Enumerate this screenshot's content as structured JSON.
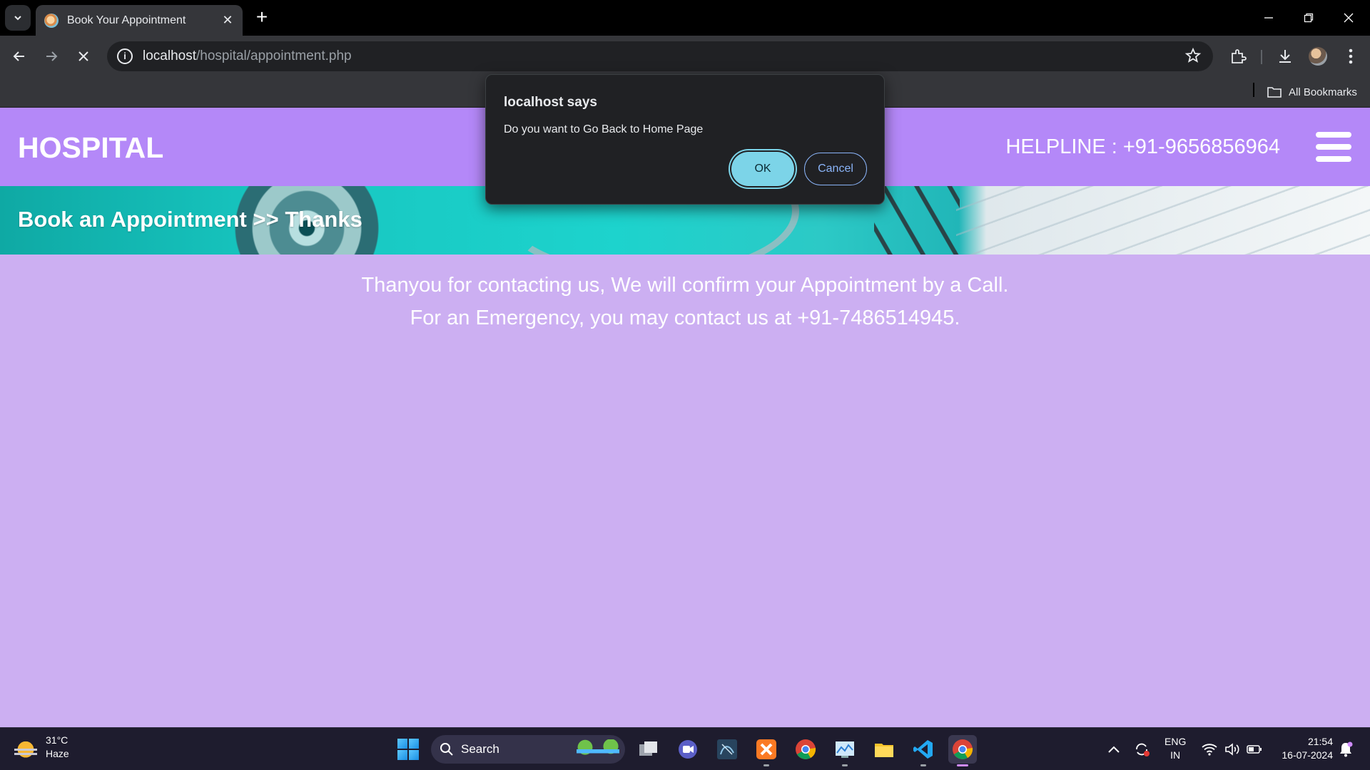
{
  "browser": {
    "tab_title": "Book Your Appointment",
    "url_host": "localhost",
    "url_path": "/hospital/appointment.php",
    "bookmarks_label": "All Bookmarks"
  },
  "site": {
    "logo": "HOSPITAL",
    "helpline": "HELPLINE : +91-9656856964",
    "breadcrumb": "Book an Appointment >> Thanks",
    "thanks_line1": "Thanyou for contacting us, We will confirm your Appointment by a Call.",
    "thanks_line2": "For an Emergency, you may contact us at +91-7486514945.",
    "colors": {
      "header": "#b488f8",
      "body": "#ccaff2"
    }
  },
  "dialog": {
    "title": "localhost says",
    "message": "Do you want to Go Back to Home Page",
    "ok_label": "OK",
    "cancel_label": "Cancel"
  },
  "taskbar": {
    "weather_temp": "31°C",
    "weather_desc": "Haze",
    "search_label": "Search",
    "lang_line1": "ENG",
    "lang_line2": "IN",
    "time": "21:54",
    "date": "16-07-2024"
  }
}
